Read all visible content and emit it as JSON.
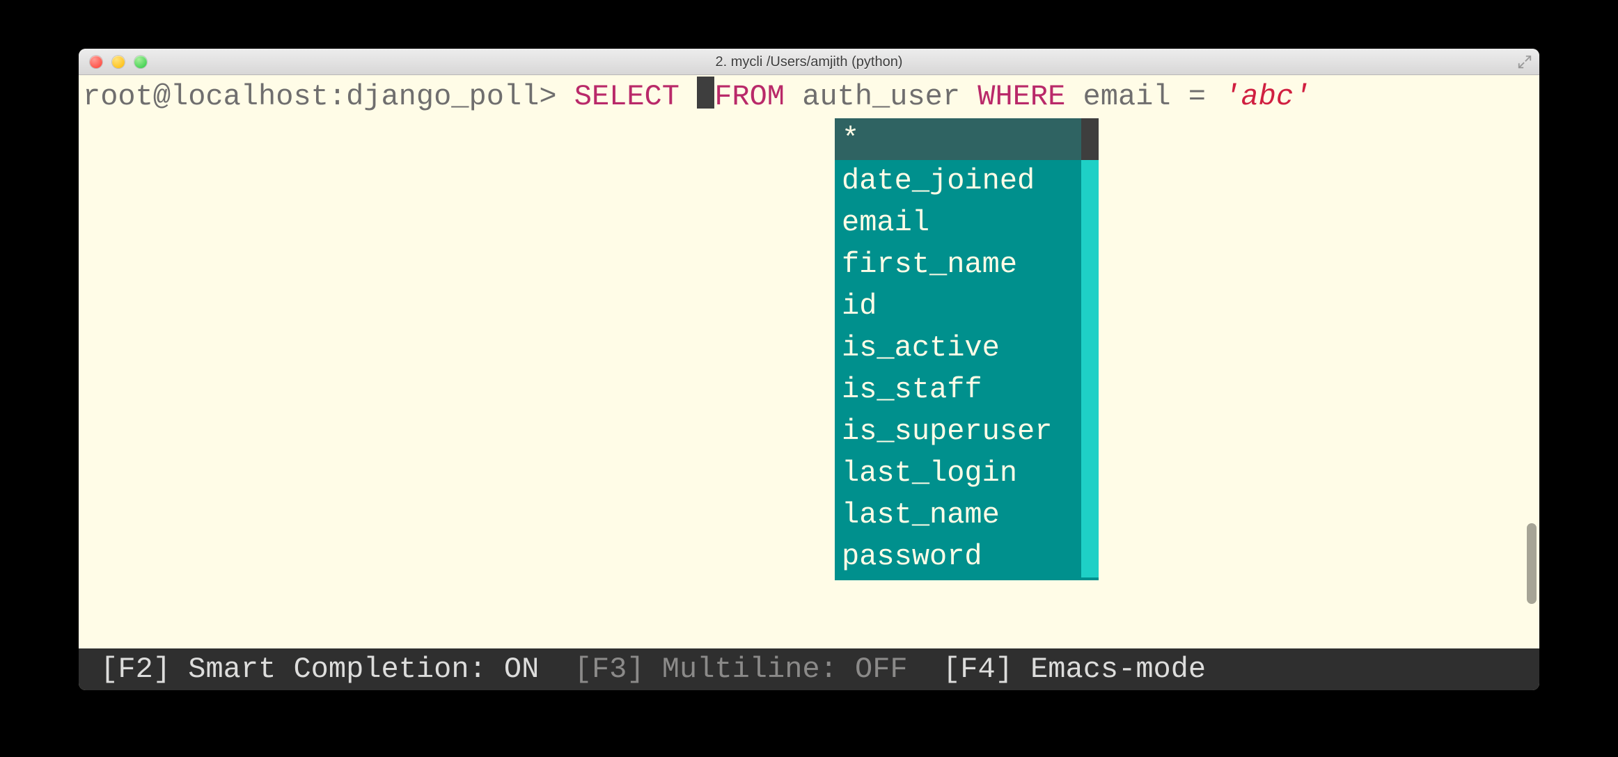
{
  "window": {
    "title": "2. mycli  /Users/amjith (python)"
  },
  "prompt": {
    "user_host": "root@localhost:",
    "database": "django_poll",
    "sep": "> ",
    "kw_select": "SELECT",
    "kw_from": "FROM",
    "table": "auth_user",
    "kw_where": "WHERE",
    "column": "email",
    "eq": "=",
    "string": "'abc'"
  },
  "completion_menu": {
    "items": [
      "*",
      "date_joined",
      "email",
      "first_name",
      "id",
      "is_active",
      "is_staff",
      "is_superuser",
      "last_login",
      "last_name",
      "password"
    ],
    "selected_index": 0
  },
  "statusbar": {
    "f2_key": "[F2]",
    "f2_label": " Smart Completion: ON  ",
    "f3_key": "[F3]",
    "f3_label": " Multiline: OFF  ",
    "f4_key": "[F4]",
    "f4_label": " Emacs-mode"
  }
}
